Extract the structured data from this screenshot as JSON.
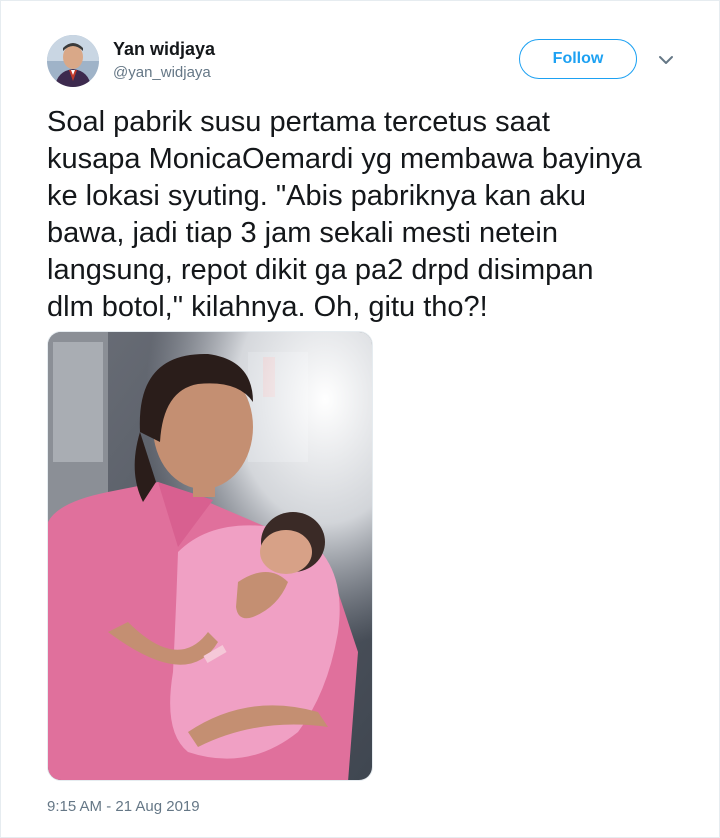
{
  "author": {
    "name": "Yan widjaya",
    "handle": "@yan_widjaya",
    "avatar_icon": "user-avatar"
  },
  "actions": {
    "follow_label": "Follow",
    "menu_icon": "chevron-down-icon"
  },
  "tweet": {
    "text": "Soal pabrik susu pertama tercetus saat\nkusapa MonicaOemardi yg membawa bayinya\nke lokasi syuting. \"Abis pabriknya kan aku\nbawa, jadi tiap 3 jam sekali mesti netein\nlangsung, repot dikit ga pa2 drpd disimpan\ndlm botol,\" kilahnya. Oh, gitu tho?!",
    "timestamp": "9:15 AM - 21 Aug 2019"
  },
  "colors": {
    "accent": "#1da1f2",
    "secondary_text": "#657786",
    "primary_text": "#14171a",
    "border": "#e6ecf0"
  }
}
